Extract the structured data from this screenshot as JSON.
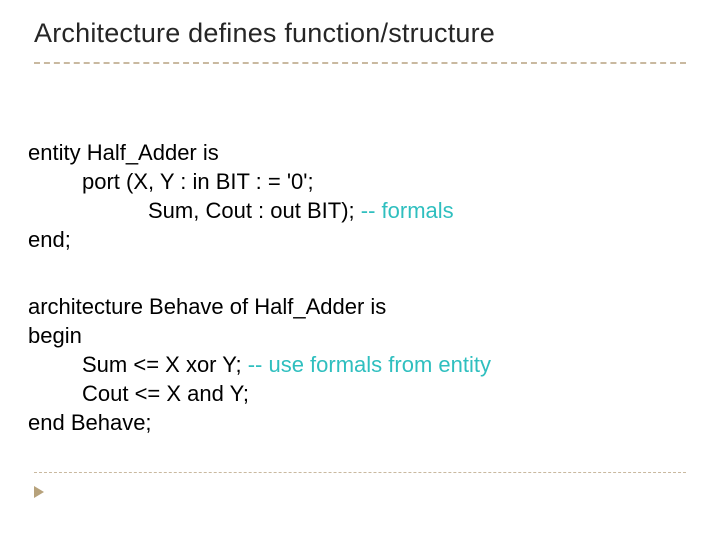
{
  "title": "Architecture defines function/structure",
  "entity": {
    "l1": "entity Half_Adder is",
    "l2": "port (X, Y : in BIT : = '0';",
    "l3": "Sum, Cout : out BIT); ",
    "l3_comment": "-- formals",
    "l4": "end;"
  },
  "arch": {
    "l1": "architecture Behave of Half_Adder is",
    "l2": "begin",
    "l3": "Sum <= X xor Y;   ",
    "l3_comment": "-- use formals from entity",
    "l4": "Cout <= X and Y;",
    "l5": "end Behave;"
  }
}
